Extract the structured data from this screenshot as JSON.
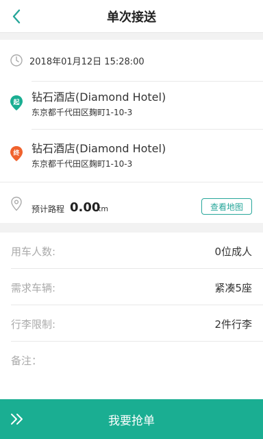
{
  "header": {
    "title": "单次接送"
  },
  "trip": {
    "datetime": "2018年01月12日 15:28:00",
    "start": {
      "badge": "起",
      "name": "钻石酒店(Diamond Hotel)",
      "address": "东京都千代田区麹町1-10-3"
    },
    "end": {
      "badge": "终",
      "name": "钻石酒店(Diamond Hotel)",
      "address": "东京都千代田区麹町1-10-3"
    },
    "distance": {
      "label": "预计路程",
      "value": "0.00",
      "unit": "km",
      "map_button": "查看地图"
    }
  },
  "details": [
    {
      "label": "用车人数:",
      "value": "0位成人"
    },
    {
      "label": "需求车辆:",
      "value": "紧凑5座"
    },
    {
      "label": "行李限制:",
      "value": "2件行李"
    },
    {
      "label": "备注：",
      "value": ""
    }
  ],
  "action": {
    "label": "我要抢单"
  },
  "colors": {
    "accent": "#26a69a",
    "start_pin": "#1aae92",
    "end_pin": "#f0622d",
    "action_bar": "#1aae92"
  }
}
